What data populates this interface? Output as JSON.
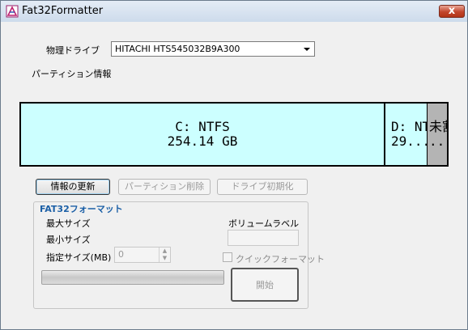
{
  "window": {
    "title": "Fat32Formatter",
    "close_glyph": "x"
  },
  "drive": {
    "label": "物理ドライブ",
    "selected": "HITACHI HTS545032B9A300"
  },
  "partition_info_label": "パーティション情報",
  "partitions": [
    {
      "line1": "C: NTFS",
      "line2": "254.14 GB",
      "color": "#ccffff"
    },
    {
      "line1": "D: NT",
      "line2": "29...",
      "color": "#ccffff"
    },
    {
      "line1": "未割",
      "line2": "...",
      "color": "#b4b4b4"
    }
  ],
  "buttons": {
    "refresh": "情報の更新",
    "delete_partition": "パーティション削除",
    "init_drive": "ドライブ初期化",
    "start": "開始"
  },
  "fat32": {
    "group_title": "FAT32フォーマット",
    "max_size_label": "最大サイズ",
    "min_size_label": "最小サイズ",
    "size_label": "指定サイズ(MB)",
    "size_value": "0",
    "volume_label_label": "ボリュームラベル",
    "volume_label_value": "",
    "quick_format_label": "クイックフォーマット",
    "progress": 0
  }
}
